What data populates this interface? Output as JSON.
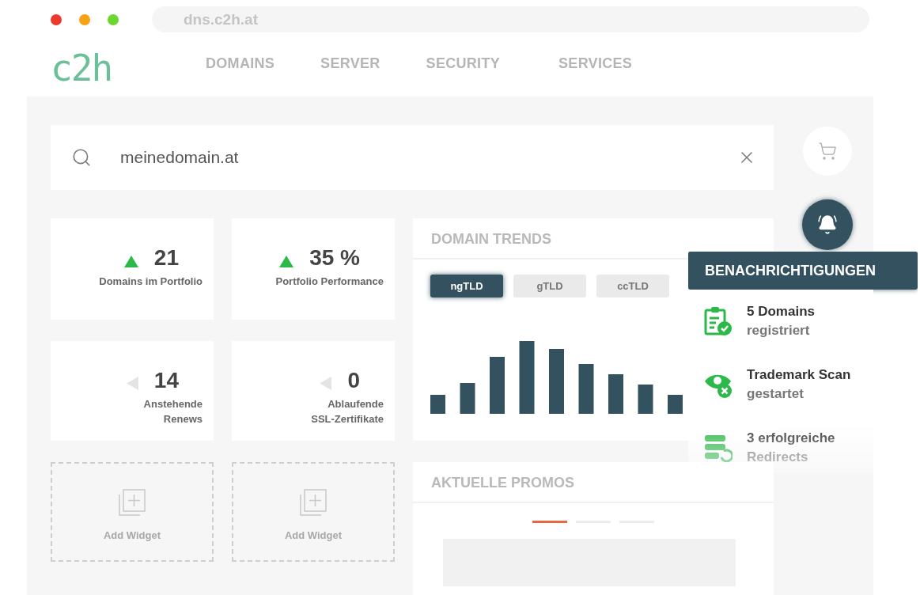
{
  "browser": {
    "url": "dns.c2h.at"
  },
  "header": {
    "logo": "c2h",
    "nav": [
      {
        "label": "DOMAINS"
      },
      {
        "label": "SERVER"
      },
      {
        "label": "SECURITY"
      },
      {
        "label": "SERVICES"
      }
    ]
  },
  "search": {
    "value": "meinedomain.at"
  },
  "stats": [
    {
      "value": "21",
      "label": "Domains im Portfolio",
      "kind": "up"
    },
    {
      "value": "35 %",
      "label": "Portfolio Performance",
      "kind": "up"
    },
    {
      "value": "14",
      "label": "Anstehende\nRenews",
      "kind": "neutral"
    },
    {
      "value": "0",
      "label": "Ablaufende\nSSL-Zertifikate",
      "kind": "neutral"
    }
  ],
  "widgets": [
    {
      "label": "Add Widget"
    },
    {
      "label": "Add Widget"
    }
  ],
  "trends": {
    "title": "DOMAIN TRENDS",
    "tabs": [
      {
        "label": "ngTLD",
        "selected": true
      },
      {
        "label": "gTLD",
        "selected": false
      },
      {
        "label": "ccTLD",
        "selected": false
      }
    ]
  },
  "promos": {
    "title": "AKTUELLE PROMOS",
    "indicators": [
      {
        "selected": true
      },
      {
        "selected": false
      },
      {
        "selected": false
      }
    ]
  },
  "notifications": {
    "title": "BENACHRICHTIGUNGEN",
    "items": [
      {
        "kind": "clipboard",
        "title": "5 Domains",
        "subtitle": "registriert"
      },
      {
        "kind": "eye",
        "title": "Trademark Scan",
        "subtitle": "gestartet"
      },
      {
        "kind": "server",
        "title": "3 erfolgreiche",
        "subtitle": "Redirects"
      }
    ]
  }
}
